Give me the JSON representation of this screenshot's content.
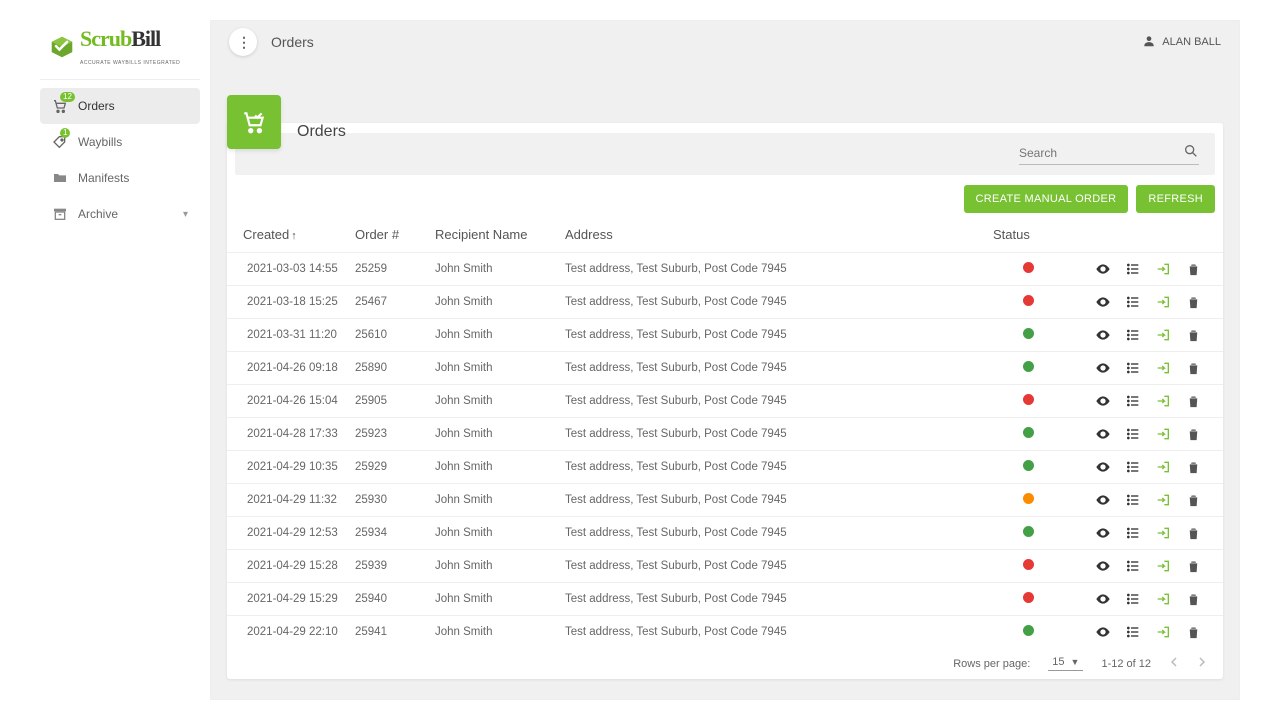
{
  "brand": {
    "name1": "Scrub",
    "name2": "Bill",
    "tag": "Accurate Waybills Integrated"
  },
  "user": {
    "name": "ALAN BALL"
  },
  "topbar": {
    "title": "Orders"
  },
  "sidebar": {
    "items": [
      {
        "label": "Orders",
        "badge": "12",
        "icon": "cart"
      },
      {
        "label": "Waybills",
        "badge": "1",
        "icon": "tag"
      },
      {
        "label": "Manifests",
        "badge": "",
        "icon": "folder"
      },
      {
        "label": "Archive",
        "badge": "",
        "icon": "archive",
        "expandable": true
      }
    ]
  },
  "page": {
    "heading": "Orders",
    "search_placeholder": "Search",
    "create_btn": "CREATE MANUAL ORDER",
    "refresh_btn": "REFRESH"
  },
  "table": {
    "headers": {
      "created": "Created",
      "order": "Order #",
      "recipient": "Recipient Name",
      "address": "Address",
      "status": "Status"
    },
    "rows": [
      {
        "created": "2021-03-03 14:55",
        "order": "25259",
        "name": "John Smith",
        "address": "Test address, Test Suburb, Post Code 7945",
        "status": "red"
      },
      {
        "created": "2021-03-18 15:25",
        "order": "25467",
        "name": "John Smith",
        "address": "Test address, Test Suburb, Post Code 7945",
        "status": "red"
      },
      {
        "created": "2021-03-31 11:20",
        "order": "25610",
        "name": "John Smith",
        "address": "Test address, Test Suburb, Post Code 7945",
        "status": "green"
      },
      {
        "created": "2021-04-26 09:18",
        "order": "25890",
        "name": "John Smith",
        "address": "Test address, Test Suburb, Post Code 7945",
        "status": "green"
      },
      {
        "created": "2021-04-26 15:04",
        "order": "25905",
        "name": "John Smith",
        "address": "Test address, Test Suburb, Post Code 7945",
        "status": "red"
      },
      {
        "created": "2021-04-28 17:33",
        "order": "25923",
        "name": "John Smith",
        "address": "Test address, Test Suburb, Post Code 7945",
        "status": "green"
      },
      {
        "created": "2021-04-29 10:35",
        "order": "25929",
        "name": "John Smith",
        "address": "Test address, Test Suburb, Post Code 7945",
        "status": "green"
      },
      {
        "created": "2021-04-29 11:32",
        "order": "25930",
        "name": "John Smith",
        "address": "Test address, Test Suburb, Post Code 7945",
        "status": "orange"
      },
      {
        "created": "2021-04-29 12:53",
        "order": "25934",
        "name": "John Smith",
        "address": "Test address, Test Suburb, Post Code 7945",
        "status": "green"
      },
      {
        "created": "2021-04-29 15:28",
        "order": "25939",
        "name": "John Smith",
        "address": "Test address, Test Suburb, Post Code 7945",
        "status": "red"
      },
      {
        "created": "2021-04-29 15:29",
        "order": "25940",
        "name": "John Smith",
        "address": "Test address, Test Suburb, Post Code 7945",
        "status": "red"
      },
      {
        "created": "2021-04-29 22:10",
        "order": "25941",
        "name": "John Smith",
        "address": "Test address, Test Suburb, Post Code 7945",
        "status": "green"
      }
    ]
  },
  "pager": {
    "rows_label": "Rows per page:",
    "rows_value": "15",
    "range": "1-12 of 12"
  }
}
